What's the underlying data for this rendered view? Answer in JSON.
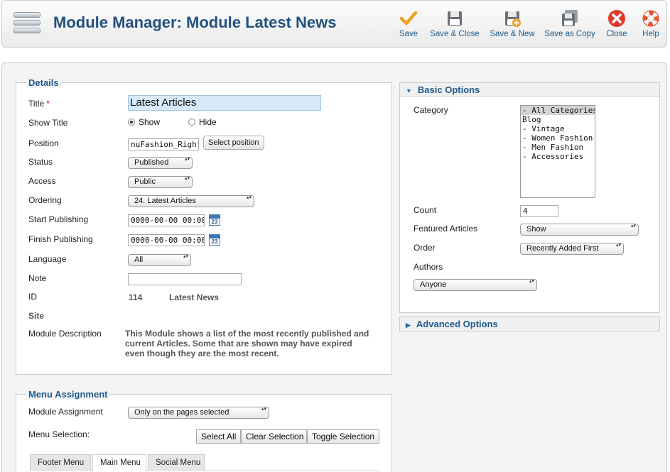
{
  "header": {
    "title": "Module Manager: Module Latest News",
    "toolbar": [
      {
        "label": "Save",
        "icon": "save-check-icon"
      },
      {
        "label": "Save & Close",
        "icon": "disk-icon"
      },
      {
        "label": "Save & New",
        "icon": "disk-plus-icon"
      },
      {
        "label": "Save as Copy",
        "icon": "disk-copy-icon"
      },
      {
        "label": "Close",
        "icon": "close-icon"
      },
      {
        "label": "Help",
        "icon": "lifebuoy-icon"
      }
    ]
  },
  "details": {
    "legend": "Details",
    "title_label": "Title",
    "required_mark": "*",
    "title_value": "Latest Articles",
    "show_title_label": "Show Title",
    "show_option": "Show",
    "hide_option": "Hide",
    "position_label": "Position",
    "position_value": "nuFashion_Right",
    "select_position": "Select position",
    "status_label": "Status",
    "status_value": "Published",
    "access_label": "Access",
    "access_value": "Public",
    "ordering_label": "Ordering",
    "ordering_value": "24. Latest Articles",
    "start_publishing_label": "Start Publishing",
    "start_publishing_value": "0000-00-00 00:00:0",
    "finish_publishing_label": "Finish Publishing",
    "finish_publishing_value": "0000-00-00 00:00:0",
    "calendar_day": "23",
    "language_label": "Language",
    "language_value": "All",
    "note_label": "Note",
    "note_value": "",
    "id_label": "ID",
    "id_value": "114",
    "module_type": "Latest News",
    "site_label": "Site",
    "module_description_label": "Module Description",
    "module_description": "This Module shows a list of the most recently published and current Articles. Some that are shown may have expired even though they are the most recent."
  },
  "menu_assignment": {
    "legend": "Menu Assignment",
    "module_assignment_label": "Module Assignment",
    "module_assignment_value": "Only on the pages selected",
    "menu_selection_label": "Menu Selection:",
    "select_all": "Select All",
    "clear_selection": "Clear Selection",
    "toggle_selection": "Toggle Selection",
    "tabs": [
      "Footer Menu",
      "Main Menu",
      "Social Menu"
    ],
    "active_tab": "Main Menu"
  },
  "basic_options": {
    "title": "Basic Options",
    "category_label": "Category",
    "categories": [
      "- All Categories -",
      "Blog",
      "- Vintage",
      "- Women Fashion",
      "- Men Fashion",
      "- Accessories"
    ],
    "selected_category": "- All Categories -",
    "count_label": "Count",
    "count_value": "4",
    "featured_label": "Featured Articles",
    "featured_value": "Show",
    "order_label": "Order",
    "order_value": "Recently Added First",
    "authors_label": "Authors",
    "authors_value": "Anyone"
  },
  "advanced_options": {
    "title": "Advanced Options"
  },
  "colors": {
    "title_blue": "#23517f",
    "link_blue": "#1f5a8c",
    "save_orange": "#f0a020",
    "close_red": "#e03a2a"
  }
}
